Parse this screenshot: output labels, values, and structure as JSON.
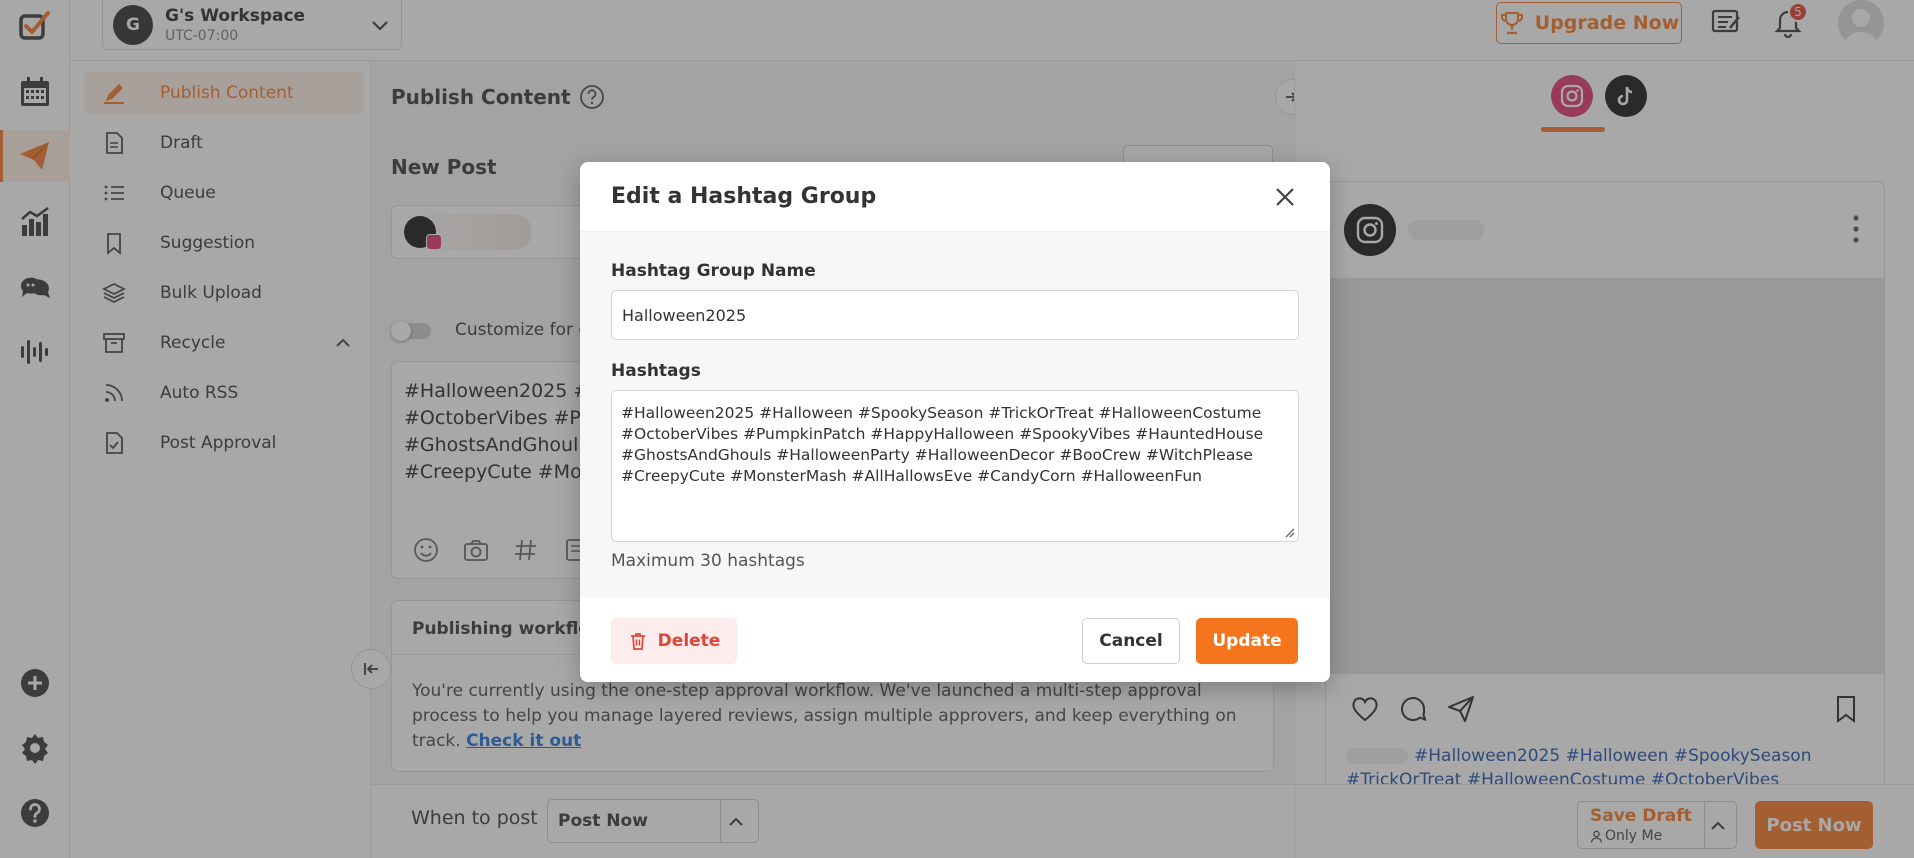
{
  "workspace": {
    "initial": "G",
    "name": "G's Workspace",
    "timezone": "UTC-07:00"
  },
  "topbar": {
    "upgrade_label": "Upgrade Now",
    "notification_count": "5"
  },
  "sidenav": {
    "items": [
      {
        "label": "Publish Content"
      },
      {
        "label": "Draft"
      },
      {
        "label": "Queue"
      },
      {
        "label": "Suggestion"
      },
      {
        "label": "Bulk Upload"
      },
      {
        "label": "Recycle"
      },
      {
        "label": "Auto RSS"
      },
      {
        "label": "Post Approval"
      }
    ]
  },
  "main": {
    "title": "Publish Content",
    "new_post": "New Post",
    "customize_label": "Customize for e",
    "editor_text": "#Halloween2025 #\n#OctoberVibes #P\n#GhostsAndGhoul\n#CreepyCute #Mo",
    "workflow_title": "Publishing workflow",
    "workflow_text": "You're currently using the one-step approval workflow. We've launched a multi-step approval process to help you manage layered reviews, assign multiple approvers, and keep everything on track. ",
    "workflow_link": "Check it out",
    "when_label": "When to post",
    "when_value": "Post Now"
  },
  "preview": {
    "caption": "#Halloween2025 #Halloween #SpookySeason #TrickOrTreat #HalloweenCostume #OctoberVibes",
    "save_draft": "Save Draft",
    "save_draft_scope": "Only Me",
    "post_now": "Post Now"
  },
  "modal": {
    "title": "Edit a Hashtag Group",
    "name_label": "Hashtag Group Name",
    "name_value": "Halloween2025",
    "hashtags_label": "Hashtags",
    "hashtags_value": "#Halloween2025 #Halloween #SpookySeason #TrickOrTreat #HalloweenCostume #OctoberVibes #PumpkinPatch #HappyHalloween #SpookyVibes #HauntedHouse #GhostsAndGhouls #HalloweenParty #HalloweenDecor #BooCrew #WitchPlease #CreepyCute #MonsterMash #AllHallowsEve #CandyCorn #HalloweenFun",
    "help_text": "Maximum 30 hashtags",
    "delete_label": "Delete",
    "cancel_label": "Cancel",
    "update_label": "Update"
  },
  "colors": {
    "accent": "#f5751f",
    "danger": "#e0453a",
    "link": "#1b6fd8"
  }
}
